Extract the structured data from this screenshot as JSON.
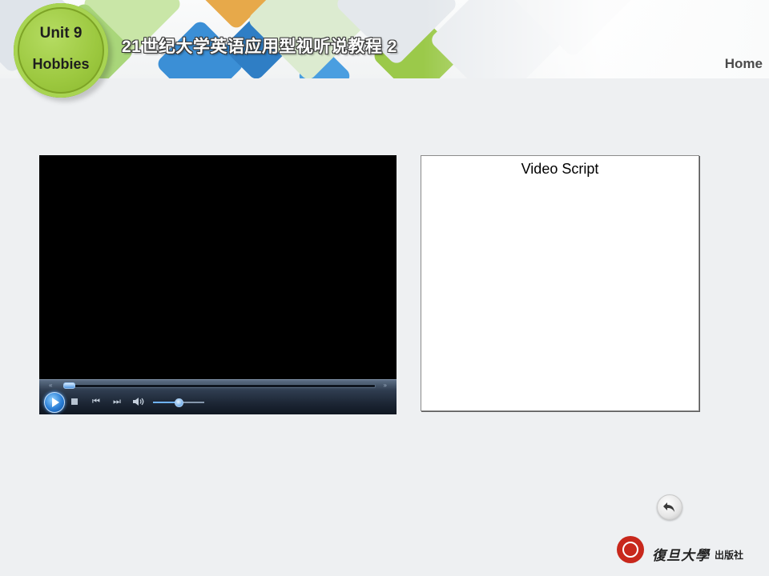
{
  "header": {
    "course_title": "21世纪大学英语应用型视听说教程 2",
    "home_label": "Home"
  },
  "badge": {
    "unit": "Unit 9",
    "topic": "Hobbies"
  },
  "player": {
    "seek_progress": 0.0,
    "volume": 0.5,
    "seek_back_glyph": "«",
    "seek_forward_glyph": "»",
    "prev_glyph": "⏮",
    "next_glyph": "⏭",
    "volume_glyph": "🔊"
  },
  "script_panel": {
    "title": "Video Script"
  },
  "publisher": {
    "name": "復旦大學",
    "suffix": "出版社"
  },
  "colors": {
    "badge_green": "#9cc83f",
    "header_orange": "#e7a94a",
    "header_blue": "#3b8fd6",
    "header_green": "#9bc94a",
    "seal_red": "#c8281c"
  },
  "icons": {
    "back": "back-arrow-icon",
    "play": "play-icon",
    "stop": "stop-icon",
    "prev": "previous-track-icon",
    "next": "next-track-icon",
    "volume": "speaker-icon"
  }
}
